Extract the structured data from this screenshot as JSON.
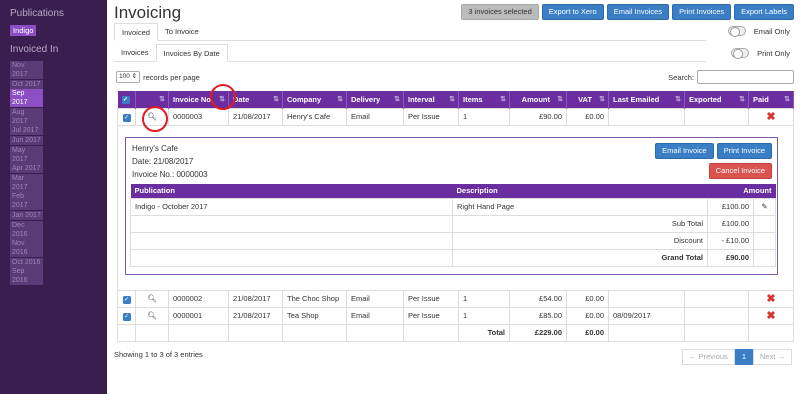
{
  "sidebar": {
    "publications_heading": "Publications",
    "publication_item": "Indigo",
    "invoiced_in_heading": "Invoiced In",
    "months": [
      "Nov 2017",
      "Oct 2017",
      "Sep 2017",
      "Aug 2017",
      "Jul 2017",
      "Jun 2017",
      "May 2017",
      "Apr 2017",
      "Mar 2017",
      "Feb 2017",
      "Jan 2017",
      "Dec 2016",
      "Nov 2016",
      "Oct 2016",
      "Sep 2016"
    ],
    "active_month": "Sep 2017"
  },
  "header": {
    "title": "Invoicing",
    "selected_count": "3 invoices selected",
    "export_xero": "Export to Xero",
    "email_invoices": "Email Invoices",
    "print_invoices": "Print Invoices",
    "export_labels": "Export Labels"
  },
  "tabs1": {
    "invoiced": "Invoiced",
    "to_invoice": "To Invoice",
    "email_only": "Email Only"
  },
  "tabs2": {
    "invoices": "Invoices",
    "invoices_by_date": "Invoices By Date",
    "print_only": "Print Only"
  },
  "controls": {
    "page_length": "100",
    "records_per_page": "records per page",
    "search_label": "Search:",
    "search_value": ""
  },
  "table": {
    "columns": [
      "",
      "",
      "Invoice No",
      "Date",
      "Company",
      "Delivery",
      "Interval",
      "Items",
      "Amount",
      "VAT",
      "Last Emailed",
      "Exported",
      "Paid"
    ],
    "rows": [
      {
        "invoice_no": "0000003",
        "date": "21/08/2017",
        "company": "Henry's Cafe",
        "delivery": "Email",
        "interval": "Per Issue",
        "items": "1",
        "amount": "£90.00",
        "vat": "£0.00",
        "last_emailed": "",
        "exported": ""
      },
      {
        "invoice_no": "0000002",
        "date": "21/08/2017",
        "company": "The Choc Shop",
        "delivery": "Email",
        "interval": "Per Issue",
        "items": "1",
        "amount": "£54.00",
        "vat": "£0.00",
        "last_emailed": "",
        "exported": ""
      },
      {
        "invoice_no": "0000001",
        "date": "21/08/2017",
        "company": "Tea Shop",
        "delivery": "Email",
        "interval": "Per Issue",
        "items": "1",
        "amount": "£85.00",
        "vat": "£0.00",
        "last_emailed": "08/09/2017",
        "exported": ""
      }
    ],
    "total_label": "Total",
    "total_amount": "£229.00",
    "total_vat": "£0.00"
  },
  "detail": {
    "company": "Henry's Cafe",
    "date_line": "Date: 21/08/2017",
    "invoice_line": "Invoice No.: 0000003",
    "email_btn": "Email Invoice",
    "print_btn": "Print Invoice",
    "cancel_btn": "Cancel Invoice",
    "columns": {
      "publication": "Publication",
      "description": "Description",
      "amount": "Amount"
    },
    "line": {
      "publication": "Indigo - October 2017",
      "description": "Right Hand Page",
      "amount": "£100.00"
    },
    "sub_total_label": "Sub Total",
    "sub_total": "£100.00",
    "discount_label": "Discount",
    "discount": "- £10.00",
    "grand_total_label": "Grand Total",
    "grand_total": "£90.00"
  },
  "footer": {
    "showing": "Showing 1 to 3 of 3 entries",
    "previous": "← Previous",
    "page": "1",
    "next": "Next →"
  }
}
